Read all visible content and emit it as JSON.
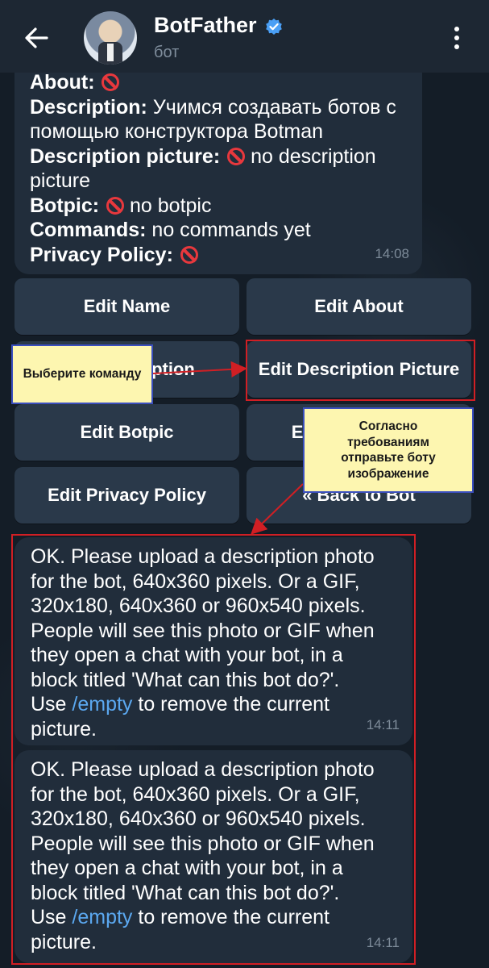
{
  "header": {
    "title": "BotFather",
    "subtitle": "бот",
    "icons": [
      "back-arrow-icon",
      "verified-icon",
      "more-vertical-icon"
    ]
  },
  "info_message": {
    "about_label": "About",
    "description_label": "Description",
    "description_value": "Учимся создавать ботов с помощью конструктора Botman",
    "description_picture_label": "Description picture",
    "description_picture_value": "no description picture",
    "botpic_label": "Botpic",
    "botpic_value": "no botpic",
    "commands_label": "Commands",
    "commands_value": "no commands yet",
    "privacy_label": "Privacy Policy",
    "time": "14:08"
  },
  "keyboard": {
    "edit_name": "Edit Name",
    "edit_about": "Edit About",
    "edit_description": "Edit Description",
    "edit_description_picture": "Edit Description Picture",
    "edit_botpic": "Edit Botpic",
    "edit_commands": "Edit Commands",
    "edit_privacy_policy": "Edit Privacy Policy",
    "back_to_bot": "« Back to Bot"
  },
  "annotations": {
    "note_1": "Выберите команду",
    "note_2": "Согласно требованиям отправьте боту изображение"
  },
  "messages": [
    {
      "text_before": "OK. Please upload a description photo\nfor the bot, 640x360 pixels. Or a GIF,\n320x180, 640x360 or 960x540 pixels.\nPeople will see this photo or GIF when\nthey open a chat with your bot, in a\nblock titled 'What can this bot do?'.\nUse ",
      "link": "/empty",
      "text_after": " to remove the current\npicture.",
      "time": "14:11"
    },
    {
      "text_before": "OK. Please upload a description photo\nfor the bot, 640x360 pixels. Or a GIF,\n320x180, 640x360 or 960x540 pixels.\nPeople will see this photo or GIF when\nthey open a chat with your bot, in a\nblock titled 'What can this bot do?'.\nUse ",
      "link": "/empty",
      "text_after": " to remove the current\npicture.",
      "time": "14:11"
    }
  ],
  "colors": {
    "background": "#141d27",
    "header": "#1d2733",
    "bubble": "#212d3b",
    "button": "#2a394a",
    "link": "#5ba8f0",
    "highlight": "#d11f24",
    "note_fill": "#fdf6b0",
    "note_border": "#3b4fbf"
  }
}
